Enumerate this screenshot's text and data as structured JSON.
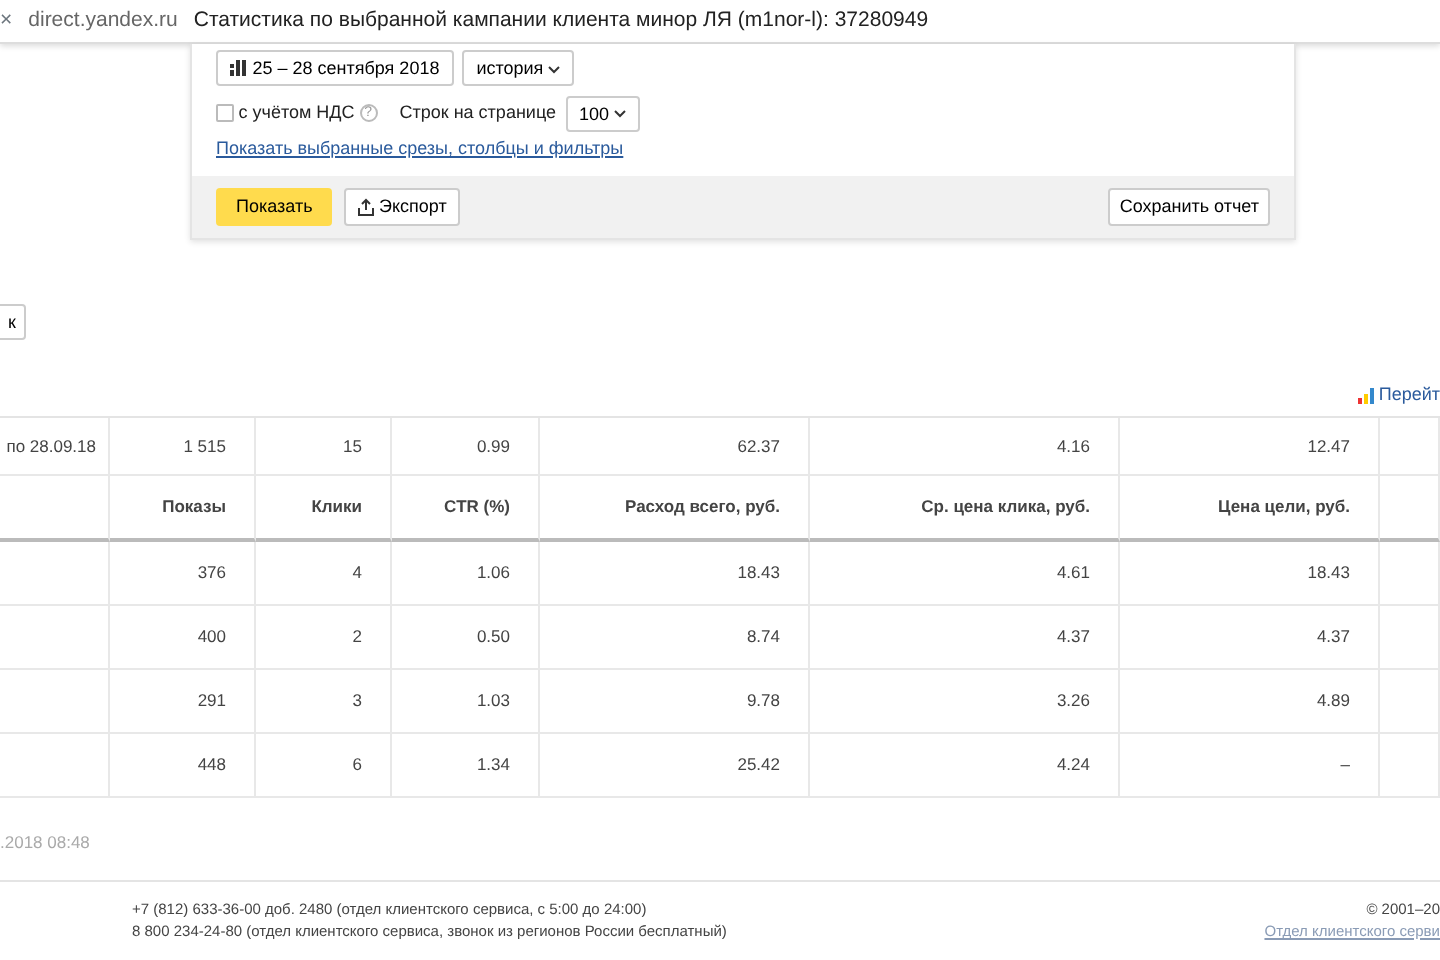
{
  "tab": {
    "close": "×",
    "domain": "direct.yandex.ru",
    "title": "Статистика по выбранной кампании клиента минор ЛЯ (m1nor-l): 37280949"
  },
  "filters": {
    "date_range": "25 – 28 сентября 2018",
    "history": "история",
    "vat": {
      "label": "с учётом НДС",
      "checked": false,
      "help": "?"
    },
    "rows_label": "Строк на странице",
    "rows_value": "100",
    "link": "Показать выбранные срезы, столбцы и фильтры"
  },
  "actions": {
    "show": "Показать",
    "export": "Экспорт",
    "save": "Сохранить отчет"
  },
  "side_button": "к",
  "goto_link": "Перейт",
  "table": {
    "total": [
      "по 28.09.18",
      "1 515",
      "15",
      "0.99",
      "62.37",
      "4.16",
      "12.47"
    ],
    "columns": [
      "",
      "Показы",
      "Клики",
      "CTR (%)",
      "Расход всего, руб.",
      "Ср. цена клика, руб.",
      "Цена цели, руб."
    ],
    "rows": [
      [
        "",
        "376",
        "4",
        "1.06",
        "18.43",
        "4.61",
        "18.43"
      ],
      [
        "",
        "400",
        "2",
        "0.50",
        "8.74",
        "4.37",
        "4.37"
      ],
      [
        "",
        "291",
        "3",
        "1.03",
        "9.78",
        "3.26",
        "4.89"
      ],
      [
        "",
        "448",
        "6",
        "1.34",
        "25.42",
        "4.24",
        "–"
      ]
    ]
  },
  "updated": ".2018 08:48",
  "footer": {
    "phones": [
      "+7 (812) 633-36-00 доб. 2480 (отдел клиентского сервиса, с 5:00 до 24:00)",
      "8 800 234-24-80 (отдел клиентского сервиса, звонок из регионов России бесплатный)"
    ],
    "copyright": "© 2001–20",
    "service_link": "Отдел клиентского серви"
  }
}
